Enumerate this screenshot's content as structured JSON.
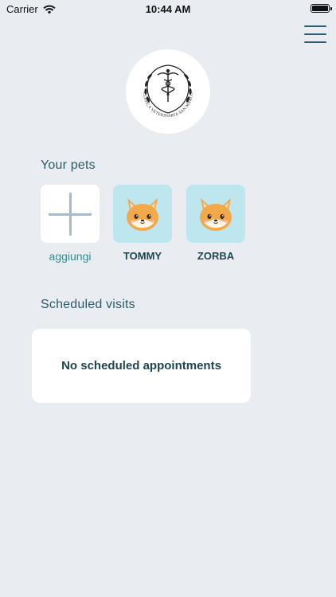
{
  "status_bar": {
    "carrier": "Carrier",
    "time": "10:44 AM"
  },
  "header": {
    "menu_icon": "hamburger-menu-icon",
    "logo_text": "CLINICA VETERINARIA SAN MARCO",
    "logo_icon": "caduceus-emblem"
  },
  "pets_section": {
    "title": "Your pets",
    "add_label": "aggiungi",
    "add_icon": "plus-icon",
    "pets": [
      {
        "name": "TOMMY",
        "icon": "fox-face-icon"
      },
      {
        "name": "ZORBA",
        "icon": "fox-face-icon"
      }
    ]
  },
  "visits_section": {
    "title": "Scheduled visits",
    "empty_message": "No scheduled appointments"
  },
  "colors": {
    "background": "#e9edf2",
    "accent": "#2a8f95",
    "pet_tile": "#bde6ee",
    "text_dark": "#1e4550"
  }
}
